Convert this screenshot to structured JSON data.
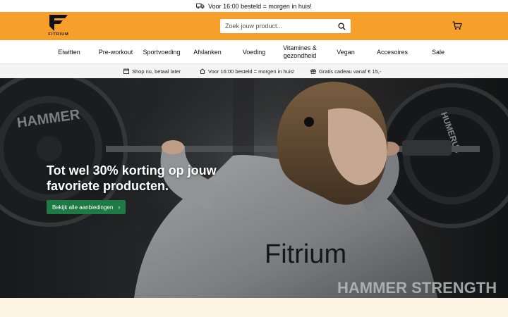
{
  "topbar": {
    "text": "Voor 16:00 besteld = morgen in huis!",
    "icon": "truck-icon"
  },
  "header": {
    "logo_text": "FITRIUM",
    "search_placeholder": "Zoek jouw product...",
    "search_icon": "search-icon",
    "cart_icon": "cart-icon",
    "background_color": "#f6a02b"
  },
  "nav": {
    "items": [
      {
        "label": "Eiwitten"
      },
      {
        "label": "Pre-workout"
      },
      {
        "label": "Sportvoeding"
      },
      {
        "label": "Afslanken"
      },
      {
        "label": "Voeding"
      },
      {
        "label": "Vitamines &",
        "label2": "gezondheid"
      },
      {
        "label": "Vegan"
      },
      {
        "label": "Accesoires"
      },
      {
        "label": "Sale"
      }
    ]
  },
  "usp": {
    "items": [
      {
        "text": "Shop nu, betaal later",
        "icon": "calendar-icon"
      },
      {
        "text": "Voor 16:00 besteld = morgen in huis!",
        "icon": "home-icon"
      },
      {
        "text": "Gratis cadeau vanaf € 15,-",
        "icon": "gift-icon"
      }
    ]
  },
  "hero": {
    "title_line1": "Tot wel 30% korting op jouw",
    "title_line2": "favoriete producten.",
    "button_label": "Bekijk alle aanbiedingen",
    "button_color": "#1d7a44",
    "hoodie_text": "Fitrium",
    "wall_text": "HAMMER STRENGTH",
    "plate_left_text": "HAMMER",
    "plate_right_text": "HUMERUS"
  },
  "colors": {
    "accent": "#f6a02b",
    "bottom_strip": "#fdf4e3"
  }
}
